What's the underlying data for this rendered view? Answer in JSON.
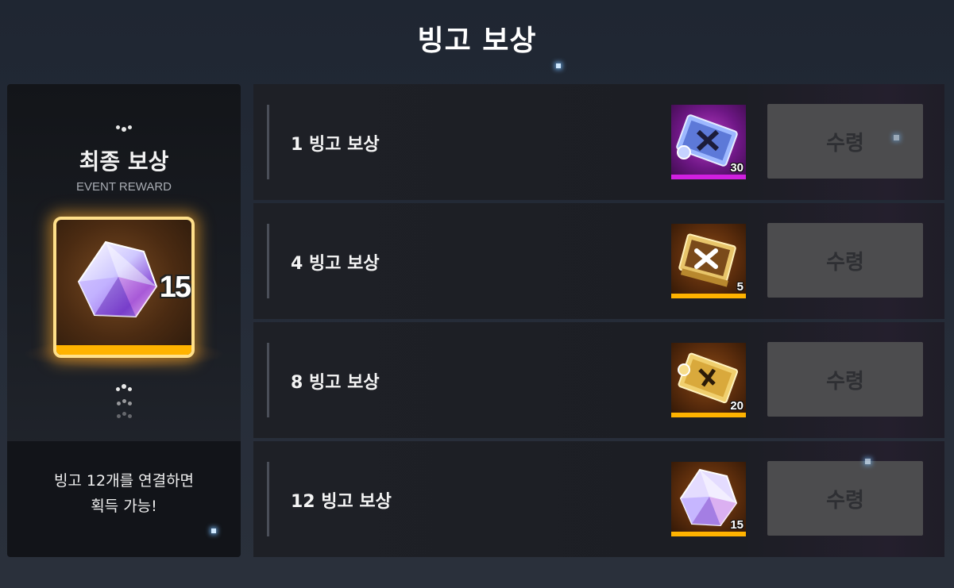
{
  "header": {
    "title": "빙고 보상"
  },
  "final_reward": {
    "title": "최종 보상",
    "subtitle": "EVENT REWARD",
    "item_count": "15",
    "description_line1": "빙고 12개를 연결하면",
    "description_line2": "획득 가능!"
  },
  "rewards": [
    {
      "label": "1 빙고 보상",
      "quantity": "30",
      "item_icon": "blue-scroll-icon",
      "button": "수령",
      "strip_color": "#d020e0"
    },
    {
      "label": "4 빙고 보상",
      "quantity": "5",
      "item_icon": "gold-crossed-swords-plate-icon",
      "button": "수령",
      "strip_color": "#ffb300"
    },
    {
      "label": "8 빙고 보상",
      "quantity": "20",
      "item_icon": "gold-scroll-icon",
      "button": "수령",
      "strip_color": "#ffb300"
    },
    {
      "label": "12 빙고 보상",
      "quantity": "15",
      "item_icon": "crystal-gem-icon",
      "button": "수령",
      "strip_color": "#ffb300"
    }
  ]
}
